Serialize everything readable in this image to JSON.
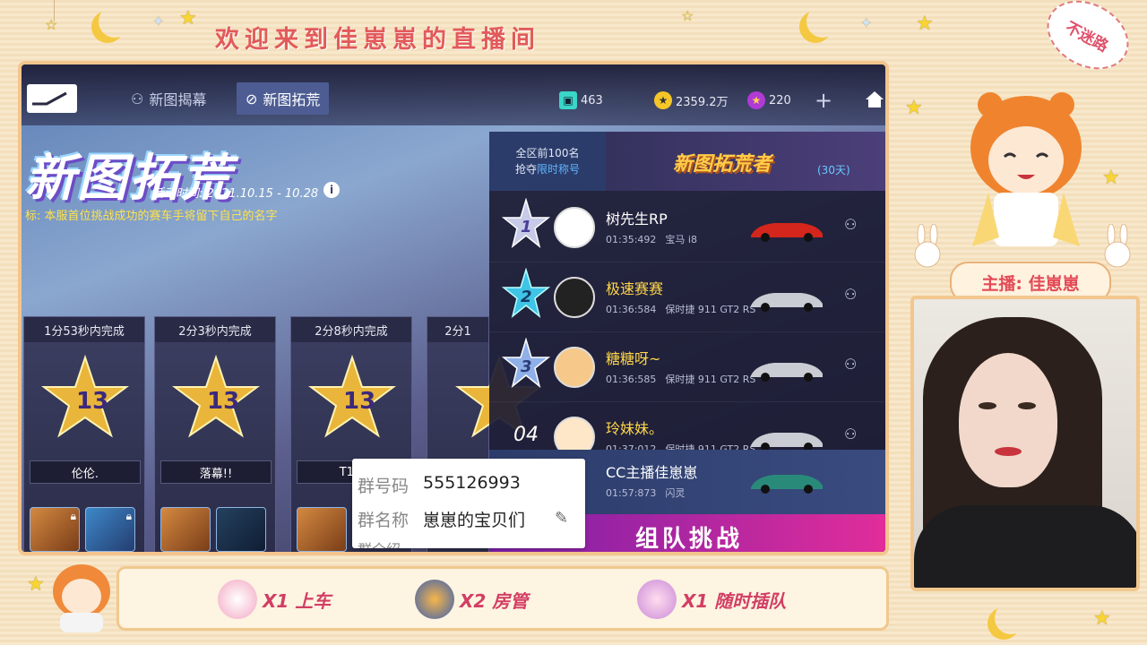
{
  "banner": "欢迎来到佳崽崽的直播间",
  "stamp": "不迷路",
  "game": {
    "tabs": [
      {
        "label": "新图揭幕",
        "active": false
      },
      {
        "label": "新图拓荒",
        "active": true
      }
    ],
    "resources": {
      "gems": "463",
      "coins": "2359.2万",
      "points": "220"
    },
    "event": {
      "title": "新图拓荒",
      "time": "活动时间: 2021.10.15 - 10.28",
      "goal": "标: 本服首位挑战成功的赛车手将留下自己的名字"
    },
    "cards": [
      {
        "time": "1分53秒内完成",
        "player": "伦伦."
      },
      {
        "time": "2分3秒内完成",
        "player": "落幕!!"
      },
      {
        "time": "2分8秒内完成",
        "player": "T1.4"
      },
      {
        "time": "2分1"
      }
    ],
    "leaderboard": {
      "head_line1": "全区前100名",
      "head_line2_a": "抢夺",
      "head_line2_b": "限时称号",
      "logo": "新图拓荒者",
      "days": "(30天)",
      "rows": [
        {
          "rank": "",
          "name": "树先生RP",
          "time": "01:35:492",
          "car": "宝马 i8",
          "gold": false
        },
        {
          "rank": "",
          "name": "极速赛赛",
          "time": "01:36:584",
          "car": "保时捷 911 GT2 RS",
          "gold": true
        },
        {
          "rank": "",
          "name": "糖糖呀~",
          "time": "01:36:585",
          "car": "保时捷 911 GT2 RS",
          "gold": true
        },
        {
          "rank": "04",
          "name": "玲妹妹。",
          "time": "01:37:012",
          "car": "保时捷 911 GT2 RS",
          "gold": true
        }
      ],
      "me": {
        "name": "CC主播佳崽崽",
        "time": "01:57:873",
        "car": "闪灵"
      },
      "team_button": "组队挑战"
    }
  },
  "popup": {
    "group_no_label": "群号码",
    "group_no": "555126993",
    "group_name_label": "群名称",
    "group_name": "崽崽的宝贝们",
    "more": "群介绍"
  },
  "bottom": [
    {
      "text": "X1 上车",
      "gift": "pink"
    },
    {
      "text": "X2 房管",
      "gift": "blue"
    },
    {
      "text": "X1 随时插队",
      "gift": "purple"
    }
  ],
  "streamer_tag": "主播: 佳崽崽",
  "colors": {
    "frame": "#f3c58d",
    "accent_red": "#e25a5a",
    "team_gradient_start": "#7a1fa8",
    "team_gradient_end": "#e22d9a"
  }
}
